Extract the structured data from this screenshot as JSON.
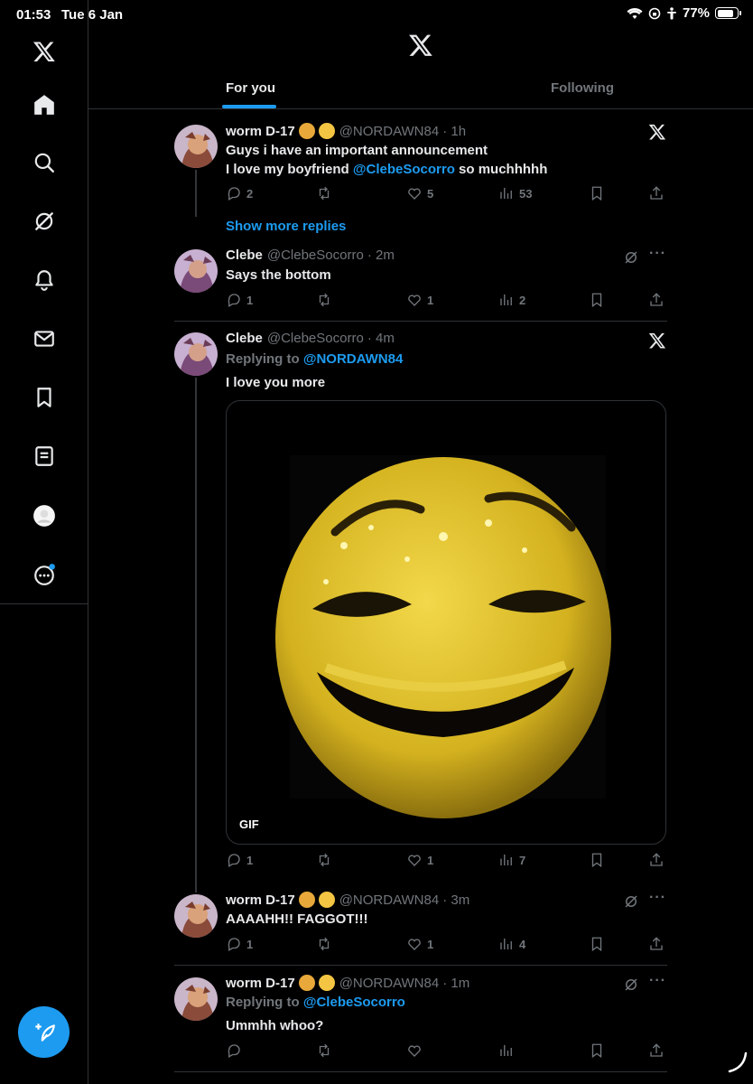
{
  "status_bar": {
    "time": "01:53",
    "date": "Tue 6 Jan",
    "battery": "77%"
  },
  "tabs": {
    "for_you": "For you",
    "following": "Following"
  },
  "show_more": "Show more replies",
  "tweets": [
    {
      "name": "worm D-17",
      "handle": "@NORDAWN84",
      "time": "· 1h",
      "line1": "Guys i have an important announcement",
      "line2_pre": "I love my boyfriend ",
      "line2_mention": "@ClebeSocorro",
      "line2_post": " so muchhhhh",
      "replies": "2",
      "reposts": "",
      "likes": "5",
      "views": "53"
    },
    {
      "name": "Clebe",
      "handle": "@ClebeSocorro",
      "time": "· 2m",
      "text": "Says the bottom",
      "replies": "1",
      "reposts": "",
      "likes": "1",
      "views": "2"
    },
    {
      "name": "Clebe",
      "handle": "@ClebeSocorro",
      "time": "· 4m",
      "replying_label": "Replying to ",
      "replying_to": "@NORDAWN84",
      "text": "I love you more",
      "media_badge": "GIF",
      "replies": "1",
      "reposts": "",
      "likes": "1",
      "views": "7"
    },
    {
      "name": "worm D-17",
      "handle": "@NORDAWN84",
      "time": "· 3m",
      "text": "AAAAHH!! FAGGOT!!!",
      "replies": "1",
      "reposts": "",
      "likes": "1",
      "views": "4"
    },
    {
      "name": "worm D-17",
      "handle": "@NORDAWN84",
      "time": "· 1m",
      "replying_label": "Replying to ",
      "replying_to": "@ClebeSocorro",
      "text": "Ummhh whoo?",
      "replies": "",
      "reposts": "",
      "likes": "",
      "views": ""
    }
  ],
  "colors": {
    "accent": "#1d9bf0",
    "background": "#000000",
    "muted": "#71767b",
    "divider": "#2f3336"
  },
  "icons": [
    "x-logo",
    "home-icon",
    "search-icon",
    "grok-icon",
    "bell-icon",
    "mail-icon",
    "bookmark-icon",
    "list-icon",
    "profile-avatar",
    "more-icon",
    "compose-icon"
  ]
}
